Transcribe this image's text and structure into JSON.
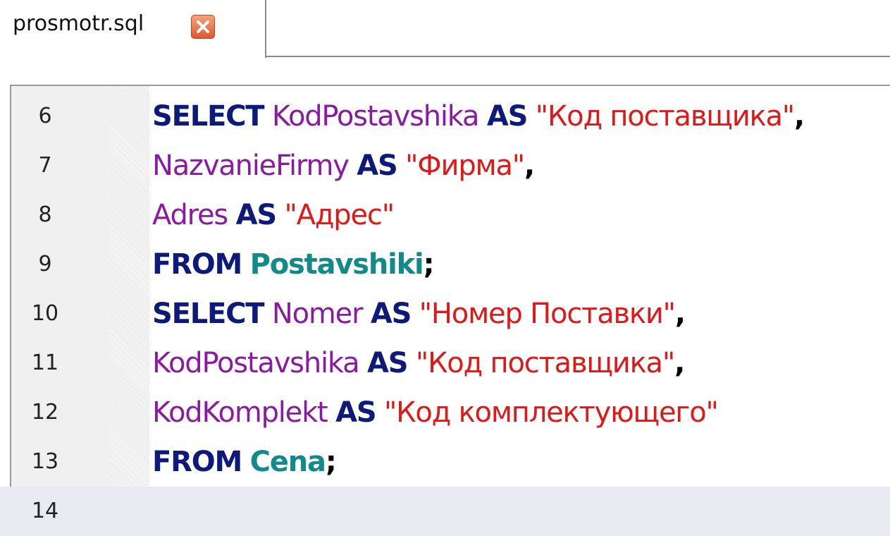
{
  "tab": {
    "filename": "prosmotr.sql",
    "close_icon": "close-icon"
  },
  "lines": [
    {
      "number": "6",
      "tokens": [
        {
          "type": "kw",
          "text": "SELECT"
        },
        {
          "type": "sp",
          "text": " "
        },
        {
          "type": "id",
          "text": "KodPostavshika"
        },
        {
          "type": "sp",
          "text": " "
        },
        {
          "type": "kw",
          "text": "AS"
        },
        {
          "type": "sp",
          "text": " "
        },
        {
          "type": "str",
          "text": "\"Код поставщика\""
        },
        {
          "type": "pn",
          "text": ","
        }
      ]
    },
    {
      "number": "7",
      "tokens": [
        {
          "type": "id",
          "text": "NazvanieFirmy"
        },
        {
          "type": "sp",
          "text": " "
        },
        {
          "type": "kw",
          "text": "AS"
        },
        {
          "type": "sp",
          "text": " "
        },
        {
          "type": "str",
          "text": "\"Фирма\""
        },
        {
          "type": "pn",
          "text": ","
        }
      ]
    },
    {
      "number": "8",
      "tokens": [
        {
          "type": "id",
          "text": "Adres"
        },
        {
          "type": "sp",
          "text": " "
        },
        {
          "type": "kw",
          "text": "AS"
        },
        {
          "type": "sp",
          "text": " "
        },
        {
          "type": "str",
          "text": "\"Адрес\""
        }
      ]
    },
    {
      "number": "9",
      "tokens": [
        {
          "type": "kw",
          "text": "FROM"
        },
        {
          "type": "sp",
          "text": " "
        },
        {
          "type": "tbl",
          "text": "Postavshiki"
        },
        {
          "type": "pn",
          "text": ";"
        }
      ]
    },
    {
      "number": "10",
      "tokens": [
        {
          "type": "kw",
          "text": "SELECT"
        },
        {
          "type": "sp",
          "text": " "
        },
        {
          "type": "id",
          "text": "Nomer"
        },
        {
          "type": "sp",
          "text": " "
        },
        {
          "type": "kw",
          "text": "AS"
        },
        {
          "type": "sp",
          "text": " "
        },
        {
          "type": "str",
          "text": "\"Номер Поставки\""
        },
        {
          "type": "pn",
          "text": ","
        }
      ]
    },
    {
      "number": "11",
      "tokens": [
        {
          "type": "id",
          "text": "KodPostavshika"
        },
        {
          "type": "sp",
          "text": " "
        },
        {
          "type": "kw",
          "text": "AS"
        },
        {
          "type": "sp",
          "text": " "
        },
        {
          "type": "str",
          "text": "\"Код поставщика\""
        },
        {
          "type": "pn",
          "text": ","
        }
      ]
    },
    {
      "number": "12",
      "tokens": [
        {
          "type": "id",
          "text": "KodKomplekt"
        },
        {
          "type": "sp",
          "text": " "
        },
        {
          "type": "kw",
          "text": "AS"
        },
        {
          "type": "sp",
          "text": " "
        },
        {
          "type": "str",
          "text": "\"Код комплектующего\""
        }
      ]
    },
    {
      "number": "13",
      "tokens": [
        {
          "type": "kw",
          "text": "FROM"
        },
        {
          "type": "sp",
          "text": " "
        },
        {
          "type": "tbl",
          "text": "Cena"
        },
        {
          "type": "pn",
          "text": ";"
        }
      ]
    },
    {
      "number": "14",
      "tokens": [],
      "current": true
    }
  ],
  "colors": {
    "keyword": "#0e1a7a",
    "identifier": "#8a1aa2",
    "string": "#e01818",
    "table": "#138a8a",
    "current_line": "#e8ecf2"
  }
}
